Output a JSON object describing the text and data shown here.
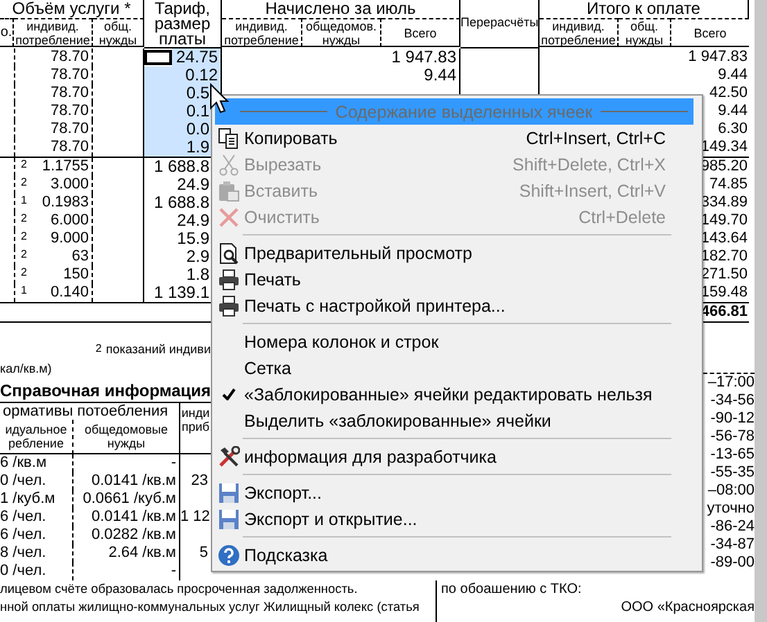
{
  "table": {
    "header": {
      "col_0": "о.",
      "volume": "Объём услуги *",
      "volume_individual": "индивид. потребление",
      "volume_common": "общ. нужды",
      "tariff": "Тариф, размер платы",
      "charged": "Начислено за июль",
      "charged_individual": "индивид. потребление",
      "charged_common": "общедомов. нужды",
      "charged_total": "Всего",
      "recalc": "Перерасчёты",
      "payable": "Итого к оплате",
      "payable_individual": "индивид. потребление",
      "payable_common": "общ. нужды",
      "payable_total": "Всего"
    },
    "groups": [
      {
        "rows": [
          {
            "volume": "78.70",
            "tariff": "24.75",
            "selected": true,
            "current": true,
            "charged_total": "1 947.83",
            "payable_total": "1 947.83"
          },
          {
            "volume": "78.70",
            "tariff": "0.12",
            "selected": true,
            "current": false,
            "charged_total": "9.44",
            "payable_total": "9.44"
          },
          {
            "volume": "78.70",
            "tariff": "0.5",
            "selected": true,
            "current": false,
            "payable_total": "42.50"
          },
          {
            "volume": "78.70",
            "tariff": "0.1",
            "selected": true,
            "current": false,
            "payable_total": "9.44"
          },
          {
            "volume": "78.70",
            "tariff": "0.0",
            "selected": true,
            "current": false,
            "payable_total": "6.30"
          },
          {
            "volume": "78.70",
            "tariff": "1.9",
            "selected": true,
            "current": false,
            "payable_total": "149.34"
          }
        ]
      },
      {
        "rows": [
          {
            "mark": "2",
            "volume": "1.1755",
            "tariff": "1 688.8",
            "selected": false,
            "current": false,
            "payable_total": "985.20"
          },
          {
            "mark": "2",
            "volume": "3.000",
            "tariff": "24.9",
            "selected": false,
            "current": false,
            "payable_total": "74.85"
          },
          {
            "mark": "1",
            "volume": "0.1983",
            "tariff": "1 688.8",
            "selected": false,
            "current": false,
            "payable_total": "334.89"
          },
          {
            "mark": "2",
            "volume": "6.000",
            "tariff": "24.9",
            "selected": false,
            "current": false,
            "payable_total": "149.70"
          },
          {
            "mark": "2",
            "volume": "9.000",
            "tariff": "15.9",
            "selected": false,
            "current": false,
            "payable_total": "143.64"
          },
          {
            "mark": "2",
            "volume": "63",
            "tariff": "2.9",
            "selected": false,
            "current": false,
            "payable_total": "182.70"
          },
          {
            "mark": "2",
            "volume": "150",
            "tariff": "1.8",
            "selected": false,
            "current": false,
            "payable_total": "271.50"
          },
          {
            "mark": "1",
            "volume": "0.140",
            "tariff": "1 139.1",
            "selected": false,
            "current": false,
            "payable_total": "159.48"
          }
        ]
      }
    ],
    "grand_total": "466.81"
  },
  "note": {
    "mark": "2",
    "text": "показаний индиви"
  },
  "units_note": "кал/кв.м)",
  "reference": {
    "title": "Справочная информация",
    "header": "ормативы потоебления",
    "columns": [
      "идуальное ребление",
      "общедомовые нужды",
      "инди приб"
    ],
    "rows": [
      {
        "individual": "6 /кв.м",
        "common": "-"
      },
      {
        "individual": "0 /чел.",
        "common": "0.0141 /кв.м",
        "col_3": "23"
      },
      {
        "individual": "1 /куб.м",
        "common": "0.0661 /куб.м"
      },
      {
        "individual": "6 /чел.",
        "common": "0.0141 /кв.м",
        "col_3": "1 12"
      },
      {
        "individual": "6 /чел.",
        "common": "0.0282 /кв.м"
      },
      {
        "individual": "8 /чел.",
        "common": "2.64 /кв.м",
        "col_3": "5"
      },
      {
        "individual": "0 /чел.",
        "common": "-"
      }
    ]
  },
  "contacts": [
    "–17:00",
    "-34-56",
    "-90-12",
    "-56-78",
    "-13-65",
    "-55-35",
    "–08:00",
    "уточно",
    "-86-24",
    "-34-87",
    "-89-00"
  ],
  "notice": [
    "лицевом счёте образовалась просроченная задолженность.",
    "нной оплаты жилищно-коммунальных услуг Жилищный колекс (статья"
  ],
  "operator": [
    "по обоашению с ТКО:",
    "ООО «Красноярская"
  ],
  "context_menu": {
    "items": [
      {
        "kind": "header",
        "label": "Содержание выделенных ячеек"
      },
      {
        "kind": "item",
        "label": "Копировать",
        "shortcut": "Ctrl+Insert, Ctrl+C",
        "disabled": false,
        "checked": false
      },
      {
        "kind": "item",
        "label": "Вырезать",
        "shortcut": "Shift+Delete, Ctrl+X",
        "disabled": true,
        "checked": false
      },
      {
        "kind": "item",
        "label": "Вставить",
        "shortcut": "Shift+Insert, Ctrl+V",
        "disabled": true,
        "checked": false
      },
      {
        "kind": "item",
        "label": "Очистить",
        "shortcut": "Ctrl+Delete",
        "disabled": true,
        "checked": false
      },
      {
        "kind": "separator"
      },
      {
        "kind": "item",
        "label": "Предварительный просмотр",
        "disabled": false,
        "checked": false
      },
      {
        "kind": "item",
        "label": "Печать",
        "disabled": false,
        "checked": false
      },
      {
        "kind": "item",
        "label": "Печать с настройкой принтера...",
        "disabled": false,
        "checked": false
      },
      {
        "kind": "separator"
      },
      {
        "kind": "item",
        "label": "Номера колонок и строк",
        "disabled": false,
        "checked": false
      },
      {
        "kind": "item",
        "label": "Сетка",
        "disabled": false,
        "checked": false
      },
      {
        "kind": "item",
        "label": "«Заблокированные» ячейки редактировать нельзя",
        "disabled": false,
        "checked": true
      },
      {
        "kind": "item",
        "label": "Выделить «заблокированные» ячейки",
        "disabled": false,
        "checked": false
      },
      {
        "kind": "separator"
      },
      {
        "kind": "item",
        "label": "информация для разработчика",
        "disabled": false,
        "checked": false
      },
      {
        "kind": "separator"
      },
      {
        "kind": "item",
        "label": "Экспорт...",
        "disabled": false,
        "checked": false
      },
      {
        "kind": "item",
        "label": "Экспорт и открытие...",
        "disabled": false,
        "checked": false
      },
      {
        "kind": "separator"
      },
      {
        "kind": "item",
        "label": "Подсказка",
        "disabled": false,
        "checked": false
      }
    ]
  }
}
